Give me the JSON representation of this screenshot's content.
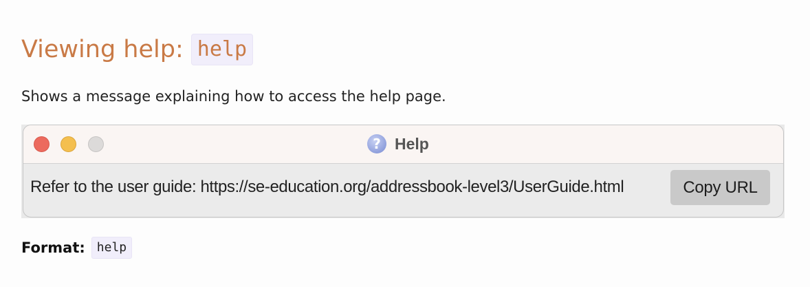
{
  "heading": {
    "text": "Viewing help:",
    "command": "help"
  },
  "description": "Shows a message explaining how to access the help page.",
  "help_window": {
    "title": "Help",
    "title_icon": "question-mark-icon",
    "traffic_lights": [
      "close",
      "minimize",
      "zoom"
    ],
    "message": "Refer to the user guide: https://se-education.org/addressbook-level3/UserGuide.html",
    "copy_button_label": "Copy URL"
  },
  "format": {
    "label": "Format:",
    "command": "help"
  },
  "colors": {
    "heading": "#c97a46",
    "code_background": "#f1eefb",
    "close_light": "#ec6a5e",
    "minimize_light": "#f4bf4f",
    "zoom_light": "#dcdad9"
  }
}
